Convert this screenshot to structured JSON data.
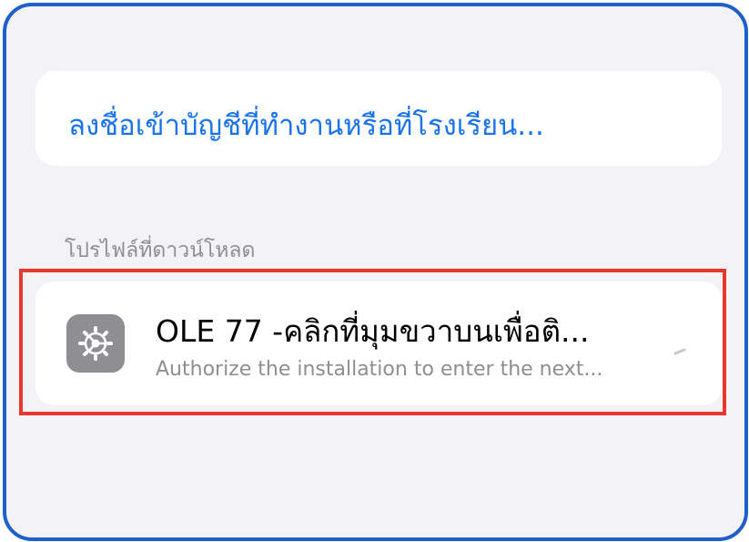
{
  "signin": {
    "link_label": "ลงชื่อเข้าบัญชีที่ทำงานหรือที่โรงเรียน..."
  },
  "downloaded_profiles": {
    "header": "โปรไฟล์ที่ดาวน์โหลด",
    "items": [
      {
        "icon": "settings-gear-icon",
        "title": "OLE 77 -คลิกที่มุมขวาบนเพื่อติ...",
        "subtitle": "Authorize the installation to enter the next..."
      }
    ]
  },
  "colors": {
    "frame_border": "#1f5fc9",
    "highlight": "#e8372f",
    "link": "#1a73e8",
    "background": "#f2f2f7",
    "icon_bg": "#8e8e93"
  }
}
